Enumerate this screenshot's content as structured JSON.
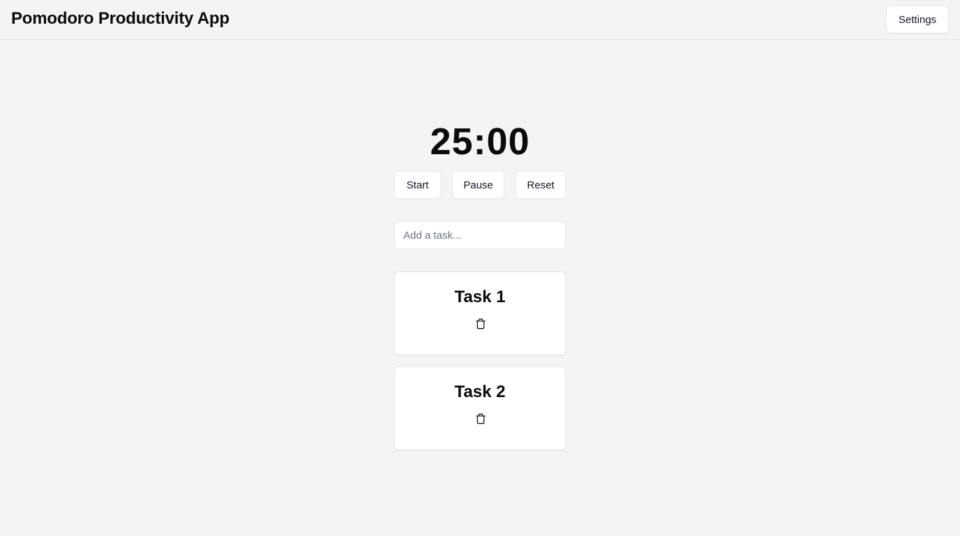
{
  "header": {
    "title": "Pomodoro Productivity App",
    "settings_label": "Settings"
  },
  "timer": {
    "display": "25:00"
  },
  "controls": {
    "start_label": "Start",
    "pause_label": "Pause",
    "reset_label": "Reset"
  },
  "task_input": {
    "placeholder": "Add a task...",
    "value": ""
  },
  "tasks": [
    {
      "title": "Task 1",
      "delete_icon": "trash-icon"
    },
    {
      "title": "Task 2",
      "delete_icon": "trash-icon"
    }
  ],
  "colors": {
    "background": "#f3f4f6",
    "card": "#ffffff",
    "border": "#e5e7eb",
    "text": "#111827"
  }
}
